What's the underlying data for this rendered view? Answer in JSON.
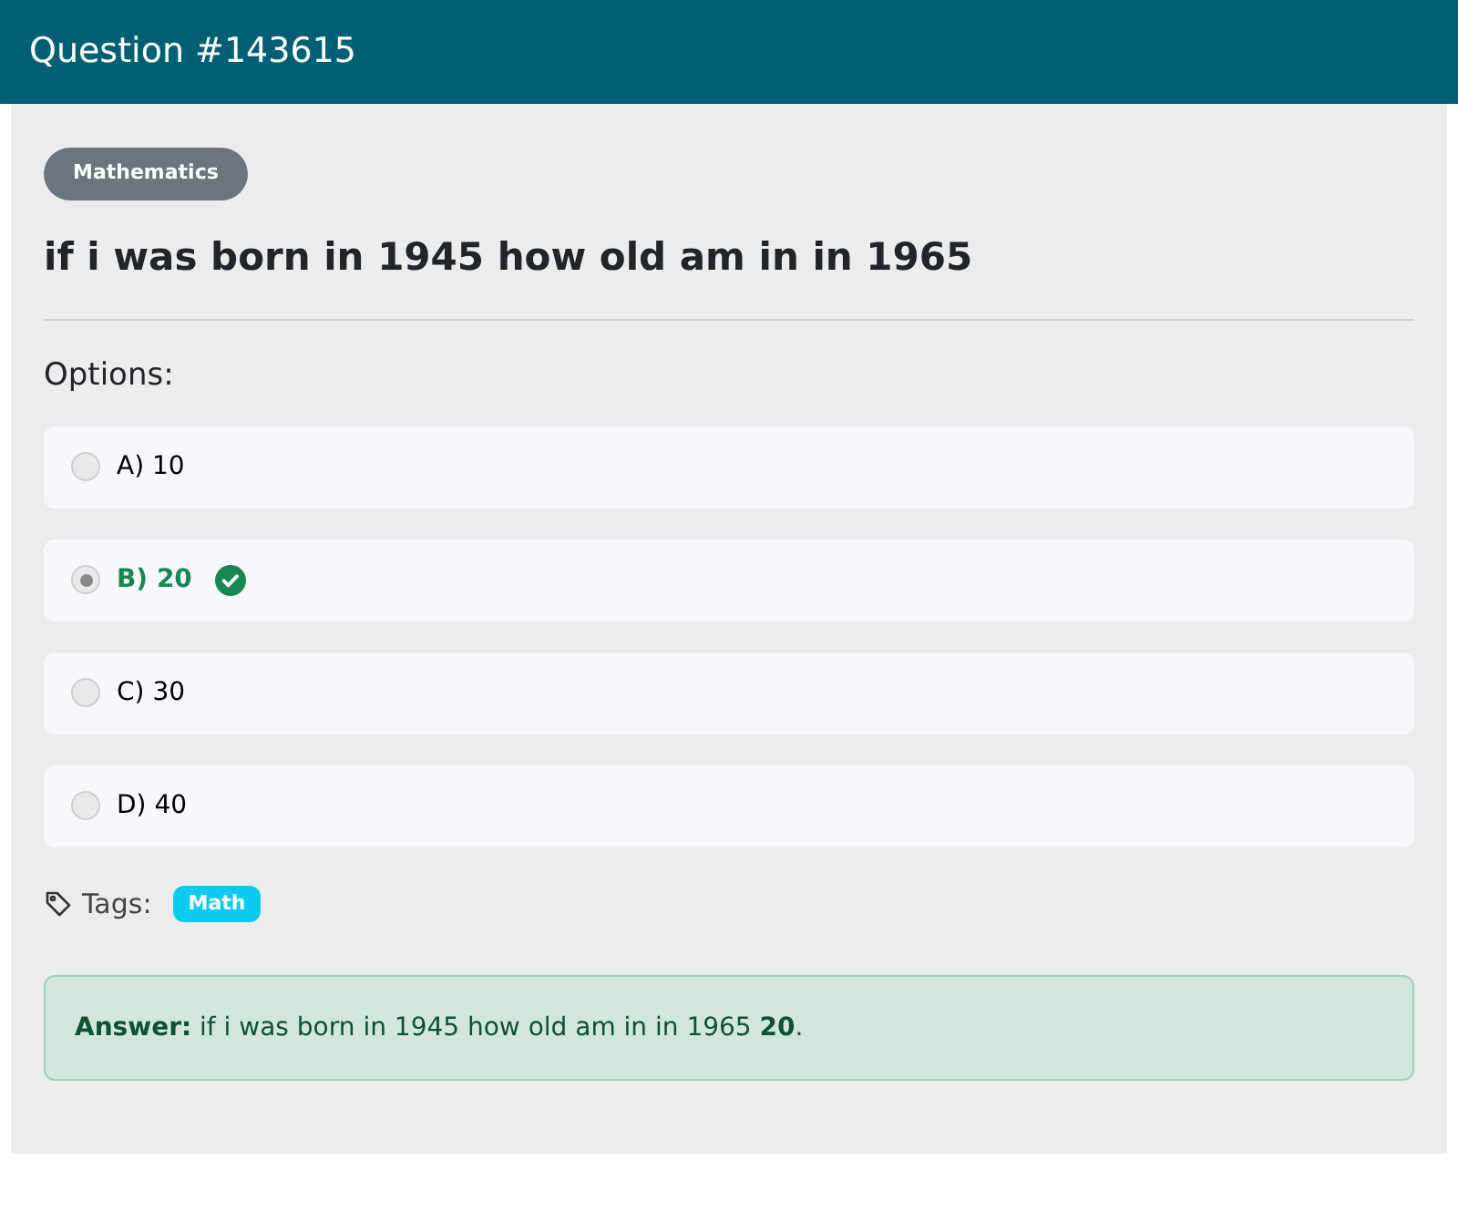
{
  "header": {
    "title": "Question #143615"
  },
  "category": "Mathematics",
  "question": "if i was born in 1945 how old am in in 1965",
  "options_label": "Options:",
  "options": [
    {
      "label": "A) 10",
      "selected": false,
      "correct": false
    },
    {
      "label": "B) 20",
      "selected": true,
      "correct": true
    },
    {
      "label": "C) 30",
      "selected": false,
      "correct": false
    },
    {
      "label": "D) 40",
      "selected": false,
      "correct": false
    }
  ],
  "tags_label": "Tags:",
  "tags": [
    "Math"
  ],
  "answer": "**Answer:** if i was born in 1945 how old am in in 1965 **20**."
}
